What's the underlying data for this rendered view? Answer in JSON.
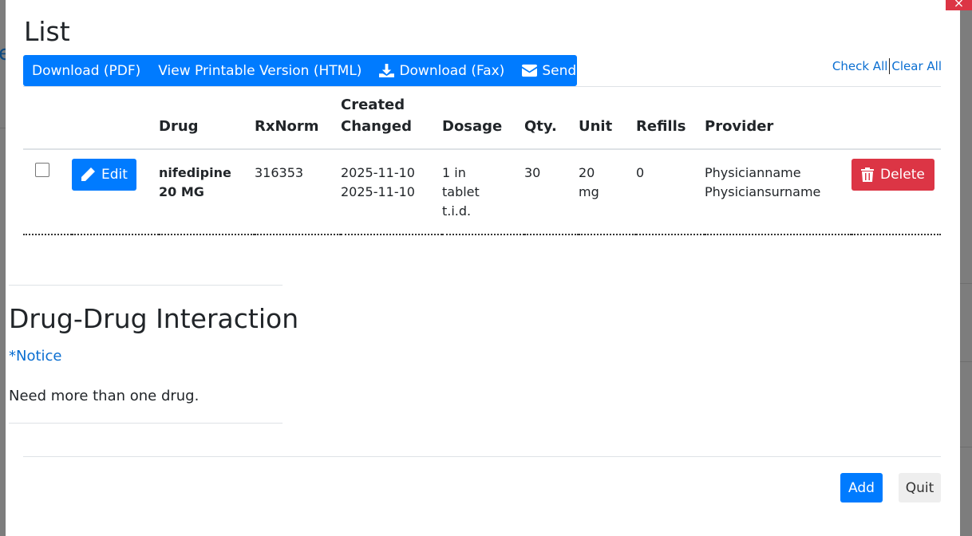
{
  "modal": {
    "title": "List",
    "close_label": "×"
  },
  "toolbar": {
    "download_pdf": "Download (PDF)",
    "view_printable": "View Printable Version (HTML)",
    "download_fax": "Download (Fax)",
    "send_email": "Send Email"
  },
  "selection": {
    "check_all": "Check All",
    "clear_all": "Clear All"
  },
  "table": {
    "headers": {
      "drug": "Drug",
      "rxnorm": "RxNorm",
      "created": "Created",
      "changed": "Changed",
      "dosage": "Dosage",
      "qty": "Qty.",
      "unit": "Unit",
      "refills": "Refills",
      "provider": "Provider"
    },
    "rows": [
      {
        "edit_label": "Edit",
        "drug_line1": "nifedipine",
        "drug_line2": "20 MG",
        "rxnorm": "316353",
        "created": "2025-11-10",
        "changed": "2025-11-10",
        "dosage_line1": "1 in",
        "dosage_line2": "tablet",
        "dosage_line3": "t.i.d.",
        "qty": "30",
        "unit_line1": "20",
        "unit_line2": "mg",
        "refills": "0",
        "provider_line1": "Physicianname",
        "provider_line2": "Physiciansurname",
        "delete_label": "Delete",
        "checked": false
      }
    ]
  },
  "interaction": {
    "title": "Drug-Drug Interaction",
    "notice": "*Notice",
    "message": "Need more than one drug."
  },
  "footer": {
    "add_label": "Add",
    "quit_label": "Quit"
  },
  "colors": {
    "primary": "#007bff",
    "danger": "#dc3545",
    "link": "#0a6ed1"
  },
  "icons": {
    "edit": "pencil-icon",
    "delete": "trash-icon",
    "download": "download-icon",
    "email": "envelope-icon"
  }
}
